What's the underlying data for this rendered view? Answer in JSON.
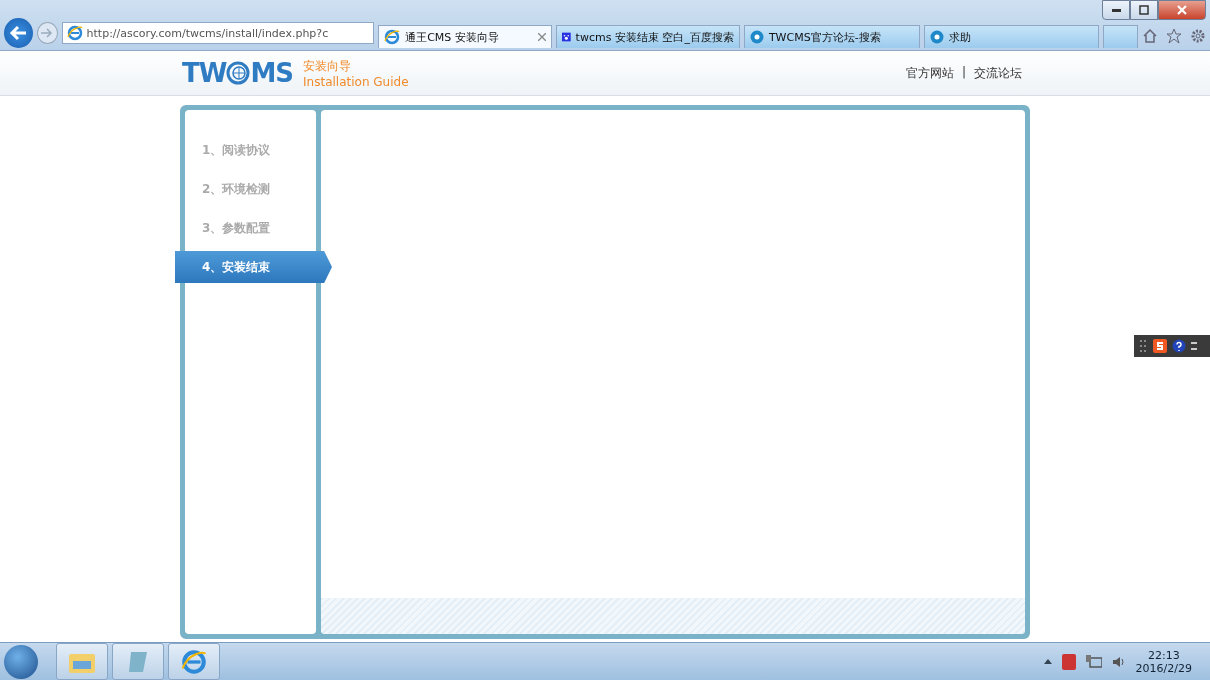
{
  "browser": {
    "address": "http://ascory.com/twcms/install/index.php?c",
    "tabs": [
      {
        "title": "通王CMS 安装向导",
        "selected": true,
        "kind": "ie"
      },
      {
        "title": "twcms 安装结束 空白_百度搜索",
        "selected": false,
        "kind": "paw"
      },
      {
        "title": "TWCMS官方论坛-搜索",
        "selected": false,
        "kind": "forum"
      },
      {
        "title": "求助",
        "selected": false,
        "kind": "forum"
      }
    ]
  },
  "header": {
    "logo_left": "TW",
    "logo_right": "MS",
    "title": "安装向导",
    "subtitle": "Installation Guide",
    "links": [
      "官方网站",
      "交流论坛"
    ],
    "separator": "|"
  },
  "steps": [
    {
      "label": "1、阅读协议",
      "selected": false
    },
    {
      "label": "2、环境检测",
      "selected": false
    },
    {
      "label": "3、参数配置",
      "selected": false
    },
    {
      "label": "4、安装结束",
      "selected": true
    }
  ],
  "taskbar": {
    "time": "22:13",
    "date": "2016/2/29"
  }
}
